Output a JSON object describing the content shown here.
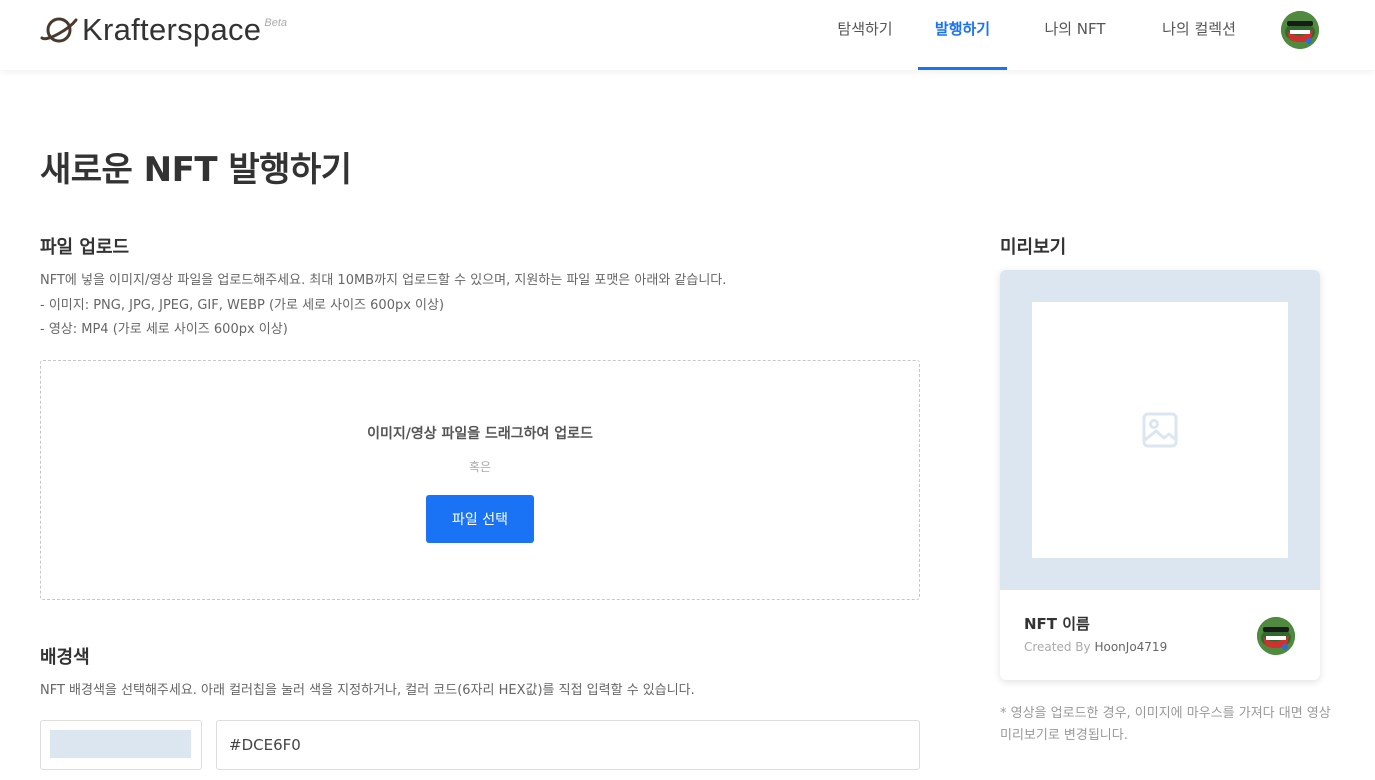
{
  "header": {
    "logo_text": "Krafterspace",
    "logo_badge": "Beta",
    "nav": [
      {
        "label": "탐색하기",
        "active": false
      },
      {
        "label": "발행하기",
        "active": true
      },
      {
        "label": "나의 NFT",
        "active": false
      },
      {
        "label": "나의 컬렉션",
        "active": false
      }
    ]
  },
  "page": {
    "title": "새로운 NFT 발행하기"
  },
  "upload": {
    "title": "파일 업로드",
    "desc_lines": [
      "NFT에 넣을 이미지/영상 파일을 업로드해주세요. 최대 10MB까지 업로드할 수 있으며, 지원하는 파일 포맷은 아래와 같습니다.",
      "- 이미지: PNG, JPG, JPEG, GIF, WEBP (가로 세로 사이즈 600px 이상)",
      "- 영상: MP4 (가로 세로 사이즈 600px 이상)"
    ],
    "dropzone_text": "이미지/영상 파일을 드래그하여 업로드",
    "or_text": "혹은",
    "button_label": "파일 선택"
  },
  "background": {
    "title": "배경색",
    "desc": "NFT 배경색을 선택해주세요. 아래 컬러칩을 눌러 색을 지정하거나, 컬러 코드(6자리 HEX값)를 직접 입력할 수 있습니다.",
    "color_value": "#DCE6F0",
    "color": "#dce6f0"
  },
  "preview": {
    "title": "미리보기",
    "nft_name": "NFT 이름",
    "created_by_label": "Created By",
    "creator": "HoonJo4719",
    "note": "* 영상을 업로드한 경우, 이미지에 마우스를 가져다 대면 영상 미리보기로 변경됩니다.",
    "image_icon": "image-placeholder-icon"
  },
  "colors": {
    "accent": "#1a73f5",
    "preview_bg": "#dce6f0"
  }
}
